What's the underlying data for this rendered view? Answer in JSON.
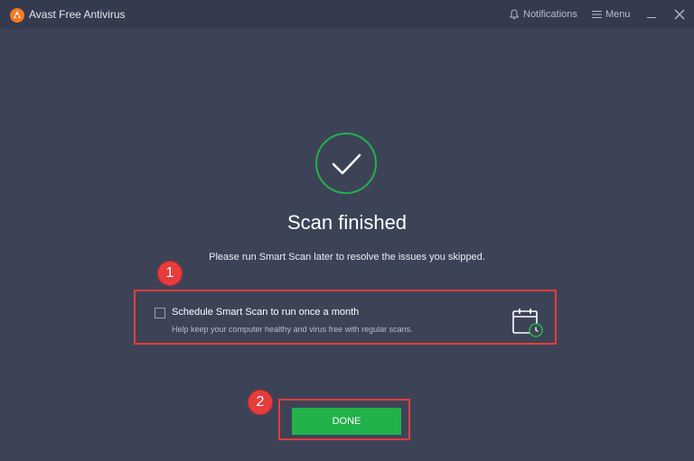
{
  "window": {
    "title": "Avast Free Antivirus",
    "notifications_label": "Notifications",
    "menu_label": "Menu"
  },
  "result": {
    "title": "Scan finished",
    "subtitle": "Please run Smart Scan later to resolve the issues you skipped."
  },
  "schedule": {
    "label": "Schedule Smart Scan to run once a month",
    "help": "Help keep your computer healthy and virus free with regular scans.",
    "checked": false
  },
  "done_button": {
    "label": "DONE"
  },
  "annotations": {
    "badge_1": "1",
    "badge_2": "2"
  },
  "colors": {
    "background": "#3d4357",
    "titlebar": "#353b4e",
    "accent_green": "#21b24b",
    "brand_orange": "#f47a20",
    "annotation_red": "#e73c3c"
  }
}
